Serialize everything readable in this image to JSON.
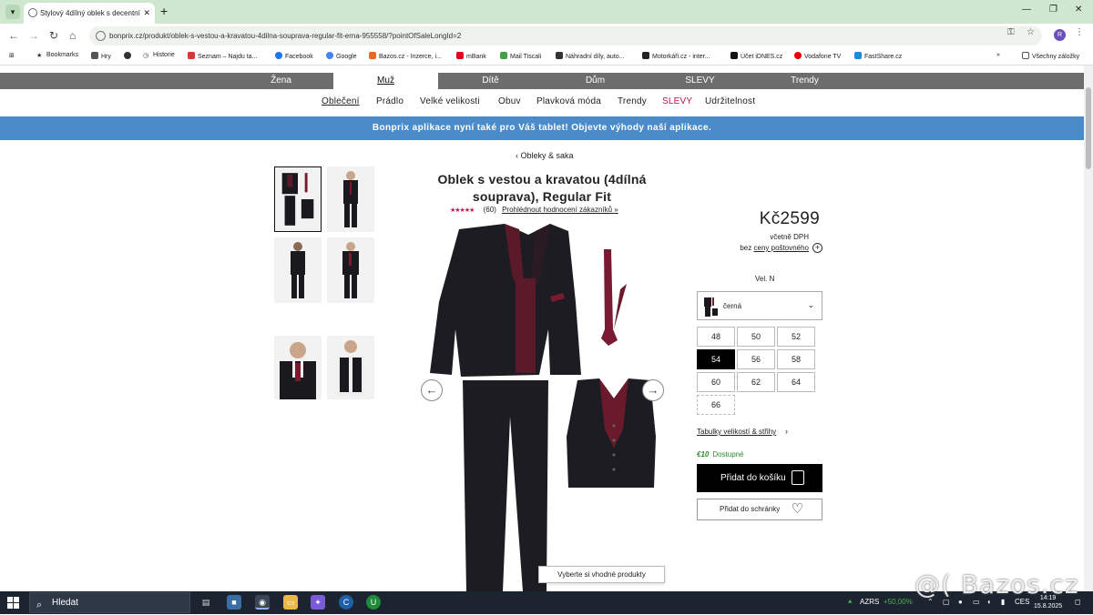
{
  "browser": {
    "tab_title": "Stylový 4dílný oblek s decentní",
    "url": "bonprix.cz/produkt/oblek-s-vestou-a-kravatou-4dilna-souprava-regular-fit-erna-955558/?pointOfSaleLongId=2",
    "profile_initial": "R",
    "bookmarks": [
      "Bookmarks",
      "Hry",
      "",
      "Historie",
      "Seznam – Najdu ta...",
      "Facebook",
      "Google",
      "Bazos.cz - Inzerce, i...",
      "mBank",
      "Mail Tiscali",
      "Náhradní díly, auto...",
      "Motorkáři.cz - inter...",
      "Účet iDNES.cz",
      "Vodafone TV",
      "FastShare.cz"
    ],
    "all_bookmarks": "Všechny záložky"
  },
  "site": {
    "main_nav": [
      "Žena",
      "Muž",
      "Dítě",
      "Dům",
      "SLEVY",
      "Trendy"
    ],
    "sub_nav": [
      "Oblečení",
      "Prádlo",
      "Velké velikosti",
      "Obuv",
      "Plavková móda",
      "Trendy",
      "SLEVY",
      "Udržitelnost"
    ],
    "banner": "Bonprix aplikace nyní také pro Váš tablet! Objevte výhody naší aplikace."
  },
  "product": {
    "breadcrumb": "Obleky & saka",
    "title": "Oblek s vestou a kravatou (4dílná souprava), Regular Fit",
    "rating_stars": "★★★★★",
    "rating_count": "(60)",
    "ratings_link": "Prohlédnout hodnocení zákazníků »",
    "price": "Kč2599",
    "vat": "včetně DPH",
    "shipping_prefix": "bez",
    "shipping_link": "ceny poštovného",
    "size_label": "Vel. N",
    "color": "černá",
    "sizes": [
      "48",
      "50",
      "52",
      "54",
      "56",
      "58",
      "60",
      "62",
      "64",
      "66"
    ],
    "selected_size": "54",
    "size_chart": "Tabulky velikostí & střihy",
    "availability_badge": "€10",
    "availability": "Dostupné",
    "add_to_cart": "Přidat do košíku",
    "add_to_wishlist": "Přidat do schránky",
    "popup": "Vyberte si vhodné produkty"
  },
  "taskbar": {
    "search_placeholder": "Hledat",
    "ticker_name": "AZRS",
    "ticker_change": "+50,00%",
    "language": "CES",
    "time": "14:19",
    "date": "15.8.2025"
  },
  "watermark": "@( Bazos.cz"
}
